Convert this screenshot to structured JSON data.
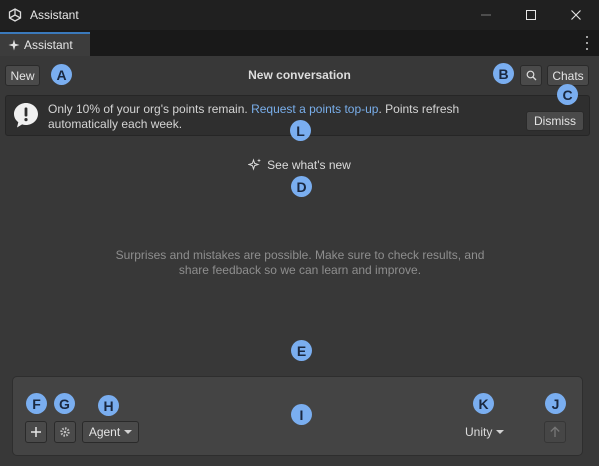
{
  "window": {
    "title": "Assistant"
  },
  "tab": {
    "label": "Assistant"
  },
  "toolbar": {
    "new_label": "New",
    "title": "New conversation",
    "chats_label": "Chats"
  },
  "banner": {
    "text_before": "Only 10% of your org's points remain. ",
    "link_text": "Request a points top-up",
    "text_after": ". Points refresh automatically each week.",
    "dismiss_label": "Dismiss"
  },
  "whats_new": {
    "label": "See what's new"
  },
  "disclaimer": "Surprises and mistakes are possible. Make sure to check results, and share feedback so we can learn and improve.",
  "composer": {
    "mode_label": "Agent",
    "context_label": "Unity"
  },
  "markers": {
    "a": "A",
    "b": "B",
    "c": "C",
    "d": "D",
    "e": "E",
    "f": "F",
    "g": "G",
    "h": "H",
    "i": "I",
    "j": "J",
    "k": "K",
    "l": "L"
  },
  "colors": {
    "accent": "#3a79bb",
    "link": "#79aeea",
    "marker": "#7aaef0",
    "background": "#383838"
  },
  "icons": [
    "unity-logo-icon",
    "minimize-icon",
    "maximize-icon",
    "close-icon",
    "sparkle-icon",
    "more-vertical-icon",
    "search-icon",
    "info-icon",
    "plus-icon",
    "gear-icon",
    "chevron-down-icon",
    "arrow-up-icon"
  ]
}
